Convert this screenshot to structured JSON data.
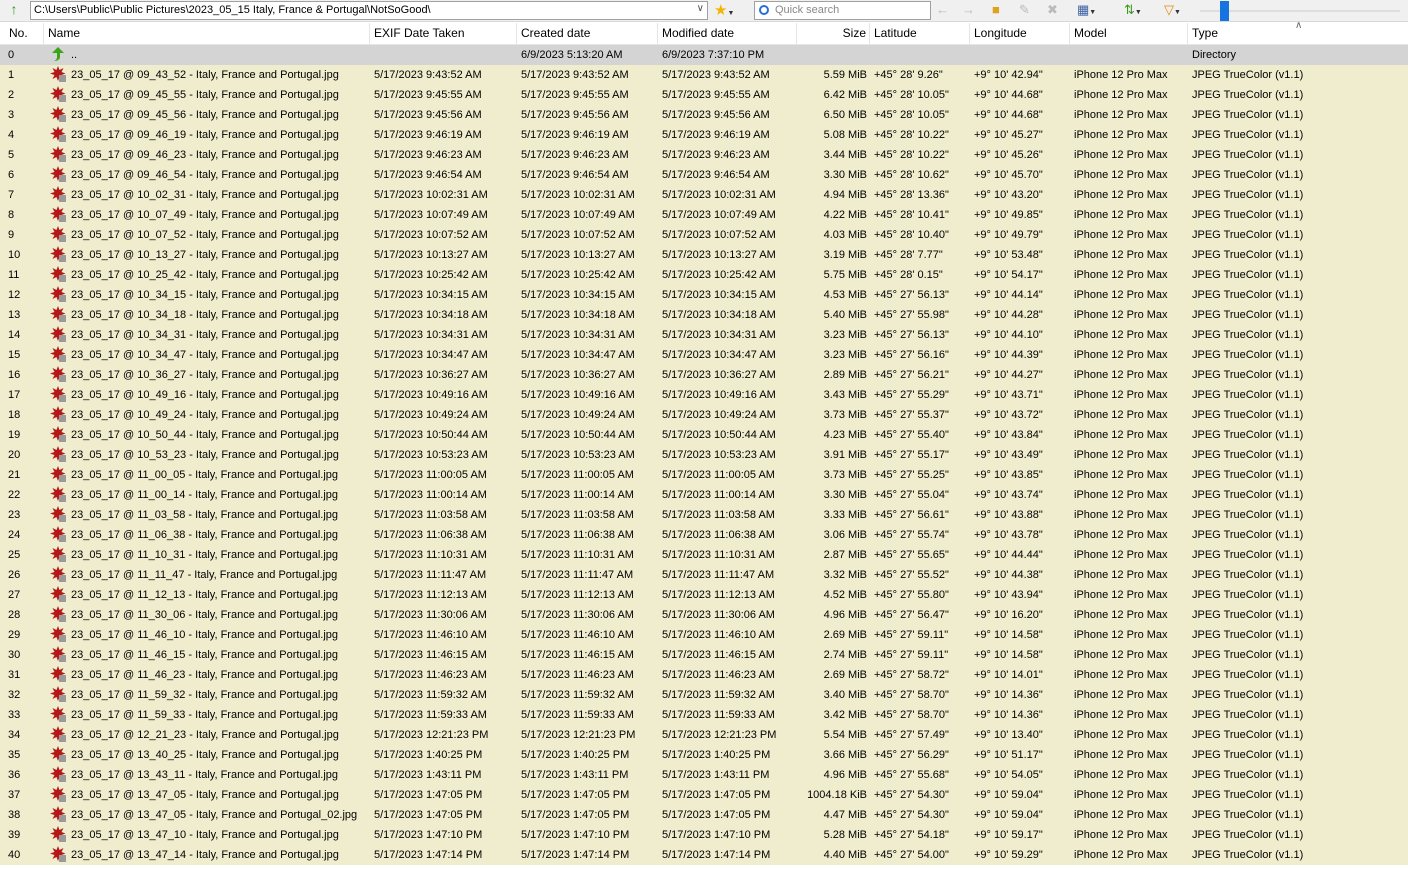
{
  "toolbar": {
    "path": "C:\\Users\\Public\\Public Pictures\\2023_05_15 Italy, France & Portugal\\NotSoGood\\",
    "search_placeholder": "Quick search"
  },
  "columns": {
    "no": "No.",
    "name": "Name",
    "exif": "EXIF Date Taken",
    "created": "Created date",
    "modified": "Modified date",
    "size": "Size",
    "lat": "Latitude",
    "lon": "Longitude",
    "model": "Model",
    "type": "Type"
  },
  "colors": {
    "row_bg": "#efedcd",
    "dir_bg": "#d4d4d4",
    "accent": "#1673e0"
  },
  "rows": [
    {
      "no": "0",
      "name": "..",
      "exif": "",
      "created": "6/9/2023 5:13:20 AM",
      "modified": "6/9/2023 7:37:10 PM",
      "size": "",
      "lat": "",
      "lon": "",
      "model": "",
      "type": "Directory",
      "icon": "up-folder-icon"
    },
    {
      "no": "1",
      "name": "23_05_17 @ 09_43_52 - Italy, France and Portugal.jpg",
      "exif": "5/17/2023 9:43:52 AM",
      "created": "5/17/2023 9:43:52 AM",
      "modified": "5/17/2023 9:43:52 AM",
      "size": "5.59 MiB",
      "lat": "+45° 28' 9.26\"",
      "lon": "+9° 10' 42.94\"",
      "model": "iPhone 12 Pro Max",
      "type": "JPEG TrueColor (v1.1)"
    },
    {
      "no": "2",
      "name": "23_05_17 @ 09_45_55 - Italy, France and Portugal.jpg",
      "exif": "5/17/2023 9:45:55 AM",
      "created": "5/17/2023 9:45:55 AM",
      "modified": "5/17/2023 9:45:55 AM",
      "size": "6.42 MiB",
      "lat": "+45° 28' 10.05\"",
      "lon": "+9° 10' 44.68\"",
      "model": "iPhone 12 Pro Max",
      "type": "JPEG TrueColor (v1.1)"
    },
    {
      "no": "3",
      "name": "23_05_17 @ 09_45_56 - Italy, France and Portugal.jpg",
      "exif": "5/17/2023 9:45:56 AM",
      "created": "5/17/2023 9:45:56 AM",
      "modified": "5/17/2023 9:45:56 AM",
      "size": "6.50 MiB",
      "lat": "+45° 28' 10.05\"",
      "lon": "+9° 10' 44.68\"",
      "model": "iPhone 12 Pro Max",
      "type": "JPEG TrueColor (v1.1)"
    },
    {
      "no": "4",
      "name": "23_05_17 @ 09_46_19 - Italy, France and Portugal.jpg",
      "exif": "5/17/2023 9:46:19 AM",
      "created": "5/17/2023 9:46:19 AM",
      "modified": "5/17/2023 9:46:19 AM",
      "size": "5.08 MiB",
      "lat": "+45° 28' 10.22\"",
      "lon": "+9° 10' 45.27\"",
      "model": "iPhone 12 Pro Max",
      "type": "JPEG TrueColor (v1.1)"
    },
    {
      "no": "5",
      "name": "23_05_17 @ 09_46_23 - Italy, France and Portugal.jpg",
      "exif": "5/17/2023 9:46:23 AM",
      "created": "5/17/2023 9:46:23 AM",
      "modified": "5/17/2023 9:46:23 AM",
      "size": "3.44 MiB",
      "lat": "+45° 28' 10.22\"",
      "lon": "+9° 10' 45.26\"",
      "model": "iPhone 12 Pro Max",
      "type": "JPEG TrueColor (v1.1)"
    },
    {
      "no": "6",
      "name": "23_05_17 @ 09_46_54 - Italy, France and Portugal.jpg",
      "exif": "5/17/2023 9:46:54 AM",
      "created": "5/17/2023 9:46:54 AM",
      "modified": "5/17/2023 9:46:54 AM",
      "size": "3.30 MiB",
      "lat": "+45° 28' 10.62\"",
      "lon": "+9° 10' 45.70\"",
      "model": "iPhone 12 Pro Max",
      "type": "JPEG TrueColor (v1.1)"
    },
    {
      "no": "7",
      "name": "23_05_17 @ 10_02_31 - Italy, France and Portugal.jpg",
      "exif": "5/17/2023 10:02:31 AM",
      "created": "5/17/2023 10:02:31 AM",
      "modified": "5/17/2023 10:02:31 AM",
      "size": "4.94 MiB",
      "lat": "+45° 28' 13.36\"",
      "lon": "+9° 10' 43.20\"",
      "model": "iPhone 12 Pro Max",
      "type": "JPEG TrueColor (v1.1)"
    },
    {
      "no": "8",
      "name": "23_05_17 @ 10_07_49 - Italy, France and Portugal.jpg",
      "exif": "5/17/2023 10:07:49 AM",
      "created": "5/17/2023 10:07:49 AM",
      "modified": "5/17/2023 10:07:49 AM",
      "size": "4.22 MiB",
      "lat": "+45° 28' 10.41\"",
      "lon": "+9° 10' 49.85\"",
      "model": "iPhone 12 Pro Max",
      "type": "JPEG TrueColor (v1.1)"
    },
    {
      "no": "9",
      "name": "23_05_17 @ 10_07_52 - Italy, France and Portugal.jpg",
      "exif": "5/17/2023 10:07:52 AM",
      "created": "5/17/2023 10:07:52 AM",
      "modified": "5/17/2023 10:07:52 AM",
      "size": "4.03 MiB",
      "lat": "+45° 28' 10.40\"",
      "lon": "+9° 10' 49.79\"",
      "model": "iPhone 12 Pro Max",
      "type": "JPEG TrueColor (v1.1)"
    },
    {
      "no": "10",
      "name": "23_05_17 @ 10_13_27 - Italy, France and Portugal.jpg",
      "exif": "5/17/2023 10:13:27 AM",
      "created": "5/17/2023 10:13:27 AM",
      "modified": "5/17/2023 10:13:27 AM",
      "size": "3.19 MiB",
      "lat": "+45° 28' 7.77\"",
      "lon": "+9° 10' 53.48\"",
      "model": "iPhone 12 Pro Max",
      "type": "JPEG TrueColor (v1.1)"
    },
    {
      "no": "11",
      "name": "23_05_17 @ 10_25_42 - Italy, France and Portugal.jpg",
      "exif": "5/17/2023 10:25:42 AM",
      "created": "5/17/2023 10:25:42 AM",
      "modified": "5/17/2023 10:25:42 AM",
      "size": "5.75 MiB",
      "lat": "+45° 28' 0.15\"",
      "lon": "+9° 10' 54.17\"",
      "model": "iPhone 12 Pro Max",
      "type": "JPEG TrueColor (v1.1)"
    },
    {
      "no": "12",
      "name": "23_05_17 @ 10_34_15 - Italy, France and Portugal.jpg",
      "exif": "5/17/2023 10:34:15 AM",
      "created": "5/17/2023 10:34:15 AM",
      "modified": "5/17/2023 10:34:15 AM",
      "size": "4.53 MiB",
      "lat": "+45° 27' 56.13\"",
      "lon": "+9° 10' 44.14\"",
      "model": "iPhone 12 Pro Max",
      "type": "JPEG TrueColor (v1.1)"
    },
    {
      "no": "13",
      "name": "23_05_17 @ 10_34_18 - Italy, France and Portugal.jpg",
      "exif": "5/17/2023 10:34:18 AM",
      "created": "5/17/2023 10:34:18 AM",
      "modified": "5/17/2023 10:34:18 AM",
      "size": "5.40 MiB",
      "lat": "+45° 27' 55.98\"",
      "lon": "+9° 10' 44.28\"",
      "model": "iPhone 12 Pro Max",
      "type": "JPEG TrueColor (v1.1)"
    },
    {
      "no": "14",
      "name": "23_05_17 @ 10_34_31 - Italy, France and Portugal.jpg",
      "exif": "5/17/2023 10:34:31 AM",
      "created": "5/17/2023 10:34:31 AM",
      "modified": "5/17/2023 10:34:31 AM",
      "size": "3.23 MiB",
      "lat": "+45° 27' 56.13\"",
      "lon": "+9° 10' 44.10\"",
      "model": "iPhone 12 Pro Max",
      "type": "JPEG TrueColor (v1.1)"
    },
    {
      "no": "15",
      "name": "23_05_17 @ 10_34_47 - Italy, France and Portugal.jpg",
      "exif": "5/17/2023 10:34:47 AM",
      "created": "5/17/2023 10:34:47 AM",
      "modified": "5/17/2023 10:34:47 AM",
      "size": "3.23 MiB",
      "lat": "+45° 27' 56.16\"",
      "lon": "+9° 10' 44.39\"",
      "model": "iPhone 12 Pro Max",
      "type": "JPEG TrueColor (v1.1)"
    },
    {
      "no": "16",
      "name": "23_05_17 @ 10_36_27 - Italy, France and Portugal.jpg",
      "exif": "5/17/2023 10:36:27 AM",
      "created": "5/17/2023 10:36:27 AM",
      "modified": "5/17/2023 10:36:27 AM",
      "size": "2.89 MiB",
      "lat": "+45° 27' 56.21\"",
      "lon": "+9° 10' 44.27\"",
      "model": "iPhone 12 Pro Max",
      "type": "JPEG TrueColor (v1.1)"
    },
    {
      "no": "17",
      "name": "23_05_17 @ 10_49_16 - Italy, France and Portugal.jpg",
      "exif": "5/17/2023 10:49:16 AM",
      "created": "5/17/2023 10:49:16 AM",
      "modified": "5/17/2023 10:49:16 AM",
      "size": "3.43 MiB",
      "lat": "+45° 27' 55.29\"",
      "lon": "+9° 10' 43.71\"",
      "model": "iPhone 12 Pro Max",
      "type": "JPEG TrueColor (v1.1)"
    },
    {
      "no": "18",
      "name": "23_05_17 @ 10_49_24 - Italy, France and Portugal.jpg",
      "exif": "5/17/2023 10:49:24 AM",
      "created": "5/17/2023 10:49:24 AM",
      "modified": "5/17/2023 10:49:24 AM",
      "size": "3.73 MiB",
      "lat": "+45° 27' 55.37\"",
      "lon": "+9° 10' 43.72\"",
      "model": "iPhone 12 Pro Max",
      "type": "JPEG TrueColor (v1.1)"
    },
    {
      "no": "19",
      "name": "23_05_17 @ 10_50_44 - Italy, France and Portugal.jpg",
      "exif": "5/17/2023 10:50:44 AM",
      "created": "5/17/2023 10:50:44 AM",
      "modified": "5/17/2023 10:50:44 AM",
      "size": "4.23 MiB",
      "lat": "+45° 27' 55.40\"",
      "lon": "+9° 10' 43.84\"",
      "model": "iPhone 12 Pro Max",
      "type": "JPEG TrueColor (v1.1)"
    },
    {
      "no": "20",
      "name": "23_05_17 @ 10_53_23 - Italy, France and Portugal.jpg",
      "exif": "5/17/2023 10:53:23 AM",
      "created": "5/17/2023 10:53:23 AM",
      "modified": "5/17/2023 10:53:23 AM",
      "size": "3.91 MiB",
      "lat": "+45° 27' 55.17\"",
      "lon": "+9° 10' 43.49\"",
      "model": "iPhone 12 Pro Max",
      "type": "JPEG TrueColor (v1.1)"
    },
    {
      "no": "21",
      "name": "23_05_17 @ 11_00_05 - Italy, France and Portugal.jpg",
      "exif": "5/17/2023 11:00:05 AM",
      "created": "5/17/2023 11:00:05 AM",
      "modified": "5/17/2023 11:00:05 AM",
      "size": "3.73 MiB",
      "lat": "+45° 27' 55.25\"",
      "lon": "+9° 10' 43.85\"",
      "model": "iPhone 12 Pro Max",
      "type": "JPEG TrueColor (v1.1)"
    },
    {
      "no": "22",
      "name": "23_05_17 @ 11_00_14 - Italy, France and Portugal.jpg",
      "exif": "5/17/2023 11:00:14 AM",
      "created": "5/17/2023 11:00:14 AM",
      "modified": "5/17/2023 11:00:14 AM",
      "size": "3.30 MiB",
      "lat": "+45° 27' 55.04\"",
      "lon": "+9° 10' 43.74\"",
      "model": "iPhone 12 Pro Max",
      "type": "JPEG TrueColor (v1.1)"
    },
    {
      "no": "23",
      "name": "23_05_17 @ 11_03_58 - Italy, France and Portugal.jpg",
      "exif": "5/17/2023 11:03:58 AM",
      "created": "5/17/2023 11:03:58 AM",
      "modified": "5/17/2023 11:03:58 AM",
      "size": "3.33 MiB",
      "lat": "+45° 27' 56.61\"",
      "lon": "+9° 10' 43.88\"",
      "model": "iPhone 12 Pro Max",
      "type": "JPEG TrueColor (v1.1)"
    },
    {
      "no": "24",
      "name": "23_05_17 @ 11_06_38 - Italy, France and Portugal.jpg",
      "exif": "5/17/2023 11:06:38 AM",
      "created": "5/17/2023 11:06:38 AM",
      "modified": "5/17/2023 11:06:38 AM",
      "size": "3.06 MiB",
      "lat": "+45° 27' 55.74\"",
      "lon": "+9° 10' 43.78\"",
      "model": "iPhone 12 Pro Max",
      "type": "JPEG TrueColor (v1.1)"
    },
    {
      "no": "25",
      "name": "23_05_17 @ 11_10_31 - Italy, France and Portugal.jpg",
      "exif": "5/17/2023 11:10:31 AM",
      "created": "5/17/2023 11:10:31 AM",
      "modified": "5/17/2023 11:10:31 AM",
      "size": "2.87 MiB",
      "lat": "+45° 27' 55.65\"",
      "lon": "+9° 10' 44.44\"",
      "model": "iPhone 12 Pro Max",
      "type": "JPEG TrueColor (v1.1)"
    },
    {
      "no": "26",
      "name": "23_05_17 @ 11_11_47 - Italy, France and Portugal.jpg",
      "exif": "5/17/2023 11:11:47 AM",
      "created": "5/17/2023 11:11:47 AM",
      "modified": "5/17/2023 11:11:47 AM",
      "size": "3.32 MiB",
      "lat": "+45° 27' 55.52\"",
      "lon": "+9° 10' 44.38\"",
      "model": "iPhone 12 Pro Max",
      "type": "JPEG TrueColor (v1.1)"
    },
    {
      "no": "27",
      "name": "23_05_17 @ 11_12_13 - Italy, France and Portugal.jpg",
      "exif": "5/17/2023 11:12:13 AM",
      "created": "5/17/2023 11:12:13 AM",
      "modified": "5/17/2023 11:12:13 AM",
      "size": "4.52 MiB",
      "lat": "+45° 27' 55.80\"",
      "lon": "+9° 10' 43.94\"",
      "model": "iPhone 12 Pro Max",
      "type": "JPEG TrueColor (v1.1)"
    },
    {
      "no": "28",
      "name": "23_05_17 @ 11_30_06 - Italy, France and Portugal.jpg",
      "exif": "5/17/2023 11:30:06 AM",
      "created": "5/17/2023 11:30:06 AM",
      "modified": "5/17/2023 11:30:06 AM",
      "size": "4.96 MiB",
      "lat": "+45° 27' 56.47\"",
      "lon": "+9° 10' 16.20\"",
      "model": "iPhone 12 Pro Max",
      "type": "JPEG TrueColor (v1.1)"
    },
    {
      "no": "29",
      "name": "23_05_17 @ 11_46_10 - Italy, France and Portugal.jpg",
      "exif": "5/17/2023 11:46:10 AM",
      "created": "5/17/2023 11:46:10 AM",
      "modified": "5/17/2023 11:46:10 AM",
      "size": "2.69 MiB",
      "lat": "+45° 27' 59.11\"",
      "lon": "+9° 10' 14.58\"",
      "model": "iPhone 12 Pro Max",
      "type": "JPEG TrueColor (v1.1)"
    },
    {
      "no": "30",
      "name": "23_05_17 @ 11_46_15 - Italy, France and Portugal.jpg",
      "exif": "5/17/2023 11:46:15 AM",
      "created": "5/17/2023 11:46:15 AM",
      "modified": "5/17/2023 11:46:15 AM",
      "size": "2.74 MiB",
      "lat": "+45° 27' 59.11\"",
      "lon": "+9° 10' 14.58\"",
      "model": "iPhone 12 Pro Max",
      "type": "JPEG TrueColor (v1.1)"
    },
    {
      "no": "31",
      "name": "23_05_17 @ 11_46_23 - Italy, France and Portugal.jpg",
      "exif": "5/17/2023 11:46:23 AM",
      "created": "5/17/2023 11:46:23 AM",
      "modified": "5/17/2023 11:46:23 AM",
      "size": "2.69 MiB",
      "lat": "+45° 27' 58.72\"",
      "lon": "+9° 10' 14.01\"",
      "model": "iPhone 12 Pro Max",
      "type": "JPEG TrueColor (v1.1)"
    },
    {
      "no": "32",
      "name": "23_05_17 @ 11_59_32 - Italy, France and Portugal.jpg",
      "exif": "5/17/2023 11:59:32 AM",
      "created": "5/17/2023 11:59:32 AM",
      "modified": "5/17/2023 11:59:32 AM",
      "size": "3.40 MiB",
      "lat": "+45° 27' 58.70\"",
      "lon": "+9° 10' 14.36\"",
      "model": "iPhone 12 Pro Max",
      "type": "JPEG TrueColor (v1.1)"
    },
    {
      "no": "33",
      "name": "23_05_17 @ 11_59_33 - Italy, France and Portugal.jpg",
      "exif": "5/17/2023 11:59:33 AM",
      "created": "5/17/2023 11:59:33 AM",
      "modified": "5/17/2023 11:59:33 AM",
      "size": "3.42 MiB",
      "lat": "+45° 27' 58.70\"",
      "lon": "+9° 10' 14.36\"",
      "model": "iPhone 12 Pro Max",
      "type": "JPEG TrueColor (v1.1)"
    },
    {
      "no": "34",
      "name": "23_05_17 @ 12_21_23 - Italy, France and Portugal.jpg",
      "exif": "5/17/2023 12:21:23 PM",
      "created": "5/17/2023 12:21:23 PM",
      "modified": "5/17/2023 12:21:23 PM",
      "size": "5.54 MiB",
      "lat": "+45° 27' 57.49\"",
      "lon": "+9° 10' 13.40\"",
      "model": "iPhone 12 Pro Max",
      "type": "JPEG TrueColor (v1.1)"
    },
    {
      "no": "35",
      "name": "23_05_17 @ 13_40_25 - Italy, France and Portugal.jpg",
      "exif": "5/17/2023 1:40:25 PM",
      "created": "5/17/2023 1:40:25 PM",
      "modified": "5/17/2023 1:40:25 PM",
      "size": "3.66 MiB",
      "lat": "+45° 27' 56.29\"",
      "lon": "+9° 10' 51.17\"",
      "model": "iPhone 12 Pro Max",
      "type": "JPEG TrueColor (v1.1)"
    },
    {
      "no": "36",
      "name": "23_05_17 @ 13_43_11 - Italy, France and Portugal.jpg",
      "exif": "5/17/2023 1:43:11 PM",
      "created": "5/17/2023 1:43:11 PM",
      "modified": "5/17/2023 1:43:11 PM",
      "size": "4.96 MiB",
      "lat": "+45° 27' 55.68\"",
      "lon": "+9° 10' 54.05\"",
      "model": "iPhone 12 Pro Max",
      "type": "JPEG TrueColor (v1.1)"
    },
    {
      "no": "37",
      "name": "23_05_17 @ 13_47_05 - Italy, France and Portugal.jpg",
      "exif": "5/17/2023 1:47:05 PM",
      "created": "5/17/2023 1:47:05 PM",
      "modified": "5/17/2023 1:47:05 PM",
      "size": "1004.18 KiB",
      "lat": "+45° 27' 54.30\"",
      "lon": "+9° 10' 59.04\"",
      "model": "iPhone 12 Pro Max",
      "type": "JPEG TrueColor (v1.1)"
    },
    {
      "no": "38",
      "name": "23_05_17 @ 13_47_05 - Italy, France and Portugal_02.jpg",
      "exif": "5/17/2023 1:47:05 PM",
      "created": "5/17/2023 1:47:05 PM",
      "modified": "5/17/2023 1:47:05 PM",
      "size": "4.47 MiB",
      "lat": "+45° 27' 54.30\"",
      "lon": "+9° 10' 59.04\"",
      "model": "iPhone 12 Pro Max",
      "type": "JPEG TrueColor (v1.1)"
    },
    {
      "no": "39",
      "name": "23_05_17 @ 13_47_10 - Italy, France and Portugal.jpg",
      "exif": "5/17/2023 1:47:10 PM",
      "created": "5/17/2023 1:47:10 PM",
      "modified": "5/17/2023 1:47:10 PM",
      "size": "5.28 MiB",
      "lat": "+45° 27' 54.18\"",
      "lon": "+9° 10' 59.17\"",
      "model": "iPhone 12 Pro Max",
      "type": "JPEG TrueColor (v1.1)"
    },
    {
      "no": "40",
      "name": "23_05_17 @ 13_47_14 - Italy, France and Portugal.jpg",
      "exif": "5/17/2023 1:47:14 PM",
      "created": "5/17/2023 1:47:14 PM",
      "modified": "5/17/2023 1:47:14 PM",
      "size": "4.40 MiB",
      "lat": "+45° 27' 54.00\"",
      "lon": "+9° 10' 59.29\"",
      "model": "iPhone 12 Pro Max",
      "type": "JPEG TrueColor (v1.1)"
    }
  ]
}
